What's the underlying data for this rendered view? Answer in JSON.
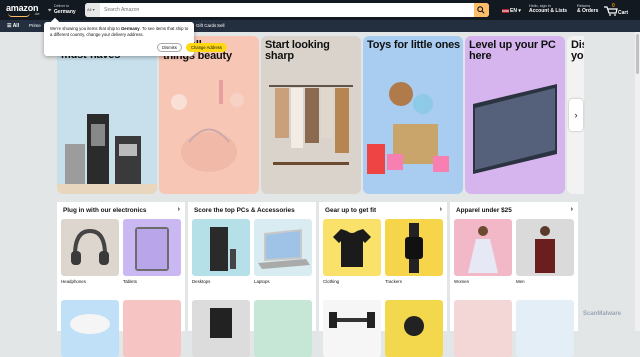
{
  "header": {
    "logo": "amazon",
    "logo_suffix": ".de",
    "deliver_line1": "Deliver to",
    "deliver_line2": "Germany",
    "search_category": "All",
    "search_placeholder": "Search Amazon",
    "language": "EN",
    "account_line1": "Hello, sign in",
    "account_line2": "Account & Lists",
    "returns_line1": "Returns",
    "returns_line2": "& Orders",
    "cart_count": "0",
    "cart_label": "Cart"
  },
  "nav": {
    "all_label": "All",
    "items": [
      "Prime",
      "Gift Cards",
      "Sell"
    ]
  },
  "popup": {
    "message_pre": "We're showing you items that ship to ",
    "message_bold": "Germany",
    "message_post": ". To see items that ship to a different country, change your delivery address.",
    "dismiss": "Dismiss",
    "change": "Change Address"
  },
  "hero_tiles": [
    {
      "title": "must-haves",
      "bg": "#c8e0ec"
    },
    {
      "title": "things beauty",
      "title_top": "all",
      "bg": "#f7c6b5"
    },
    {
      "title": "Start looking sharp",
      "bg": "#d9d3cc"
    },
    {
      "title": "Toys for little ones",
      "bg": "#a9cdf0"
    },
    {
      "title": "Level up your PC here",
      "bg": "#d6b5ef"
    },
    {
      "title": "Dis yo",
      "bg": "#f2f2f2"
    }
  ],
  "cards": [
    {
      "title": "Plug in with our electronics",
      "items": [
        {
          "label": "Headphones",
          "bg": "#dcd6cf"
        },
        {
          "label": "Tablets",
          "bg": "#c9b8f2"
        },
        {
          "label": "",
          "bg": "#bfe0f7"
        },
        {
          "label": "",
          "bg": "#f7c4c4"
        }
      ]
    },
    {
      "title": "Score the top PCs & Accessories",
      "items": [
        {
          "label": "Desktops",
          "bg": "#b6e0e8"
        },
        {
          "label": "Laptops",
          "bg": "#d8ecf2"
        },
        {
          "label": "",
          "bg": "#dcdcdc"
        },
        {
          "label": "",
          "bg": "#c6e6d6"
        }
      ]
    },
    {
      "title": "Gear up to get fit",
      "items": [
        {
          "label": "Clothing",
          "bg": "#fae16a"
        },
        {
          "label": "Trackers",
          "bg": "#f7d54a"
        },
        {
          "label": "",
          "bg": "#f6f6f6"
        },
        {
          "label": "",
          "bg": "#f3d84e"
        }
      ]
    },
    {
      "title": "Apparel under $25",
      "items": [
        {
          "label": "Women",
          "bg": "#f2b8c8"
        },
        {
          "label": "Men",
          "bg": "#dadada"
        },
        {
          "label": "",
          "bg": "#f3d7d7"
        },
        {
          "label": "",
          "bg": "#e3eef6"
        }
      ]
    }
  ],
  "watermark": "ScanMalware"
}
